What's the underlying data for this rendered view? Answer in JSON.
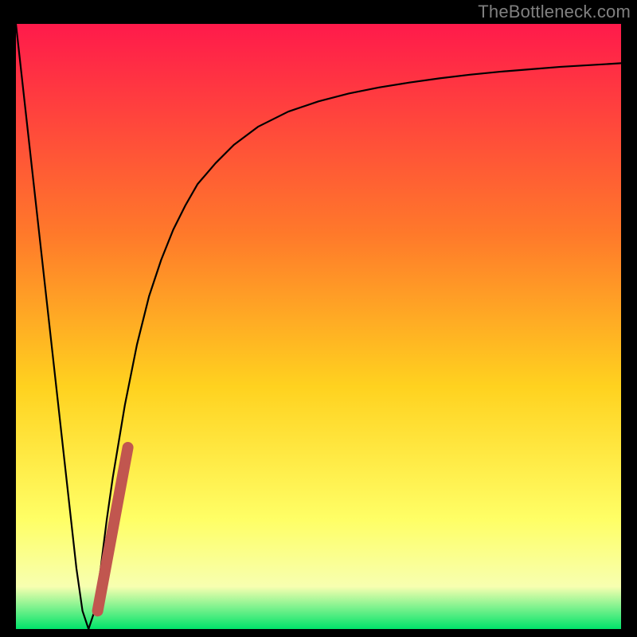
{
  "watermark": "TheBottleneck.com",
  "colors": {
    "gradient_top": "#ff1a4b",
    "gradient_mid1": "#ff7a2a",
    "gradient_mid2": "#ffd21f",
    "gradient_mid3": "#ffff66",
    "gradient_mid4": "#f7ffb0",
    "gradient_bottom": "#00e46a",
    "frame": "#000000",
    "curve": "#000000",
    "marker": "#c1564f"
  },
  "chart_data": {
    "type": "line",
    "title": "",
    "xlabel": "",
    "ylabel": "",
    "xlim": [
      0,
      100
    ],
    "ylim": [
      0,
      100
    ],
    "series": [
      {
        "name": "bottleneck-curve",
        "x": [
          0,
          2,
          4,
          6,
          8,
          10,
          11,
          12,
          13,
          14,
          15,
          16,
          18,
          20,
          22,
          24,
          26,
          28,
          30,
          33,
          36,
          40,
          45,
          50,
          55,
          60,
          65,
          70,
          75,
          80,
          85,
          90,
          95,
          100
        ],
        "values": [
          100,
          82,
          64,
          46,
          28,
          10,
          3,
          0,
          3,
          10,
          18,
          25,
          37,
          47,
          55,
          61,
          66,
          70,
          73.5,
          77,
          80,
          83,
          85.5,
          87.2,
          88.5,
          89.5,
          90.3,
          91,
          91.6,
          92.1,
          92.5,
          92.9,
          93.2,
          93.5
        ]
      },
      {
        "name": "marker-segment",
        "x": [
          13.5,
          18.5
        ],
        "values": [
          3,
          30
        ]
      }
    ]
  }
}
